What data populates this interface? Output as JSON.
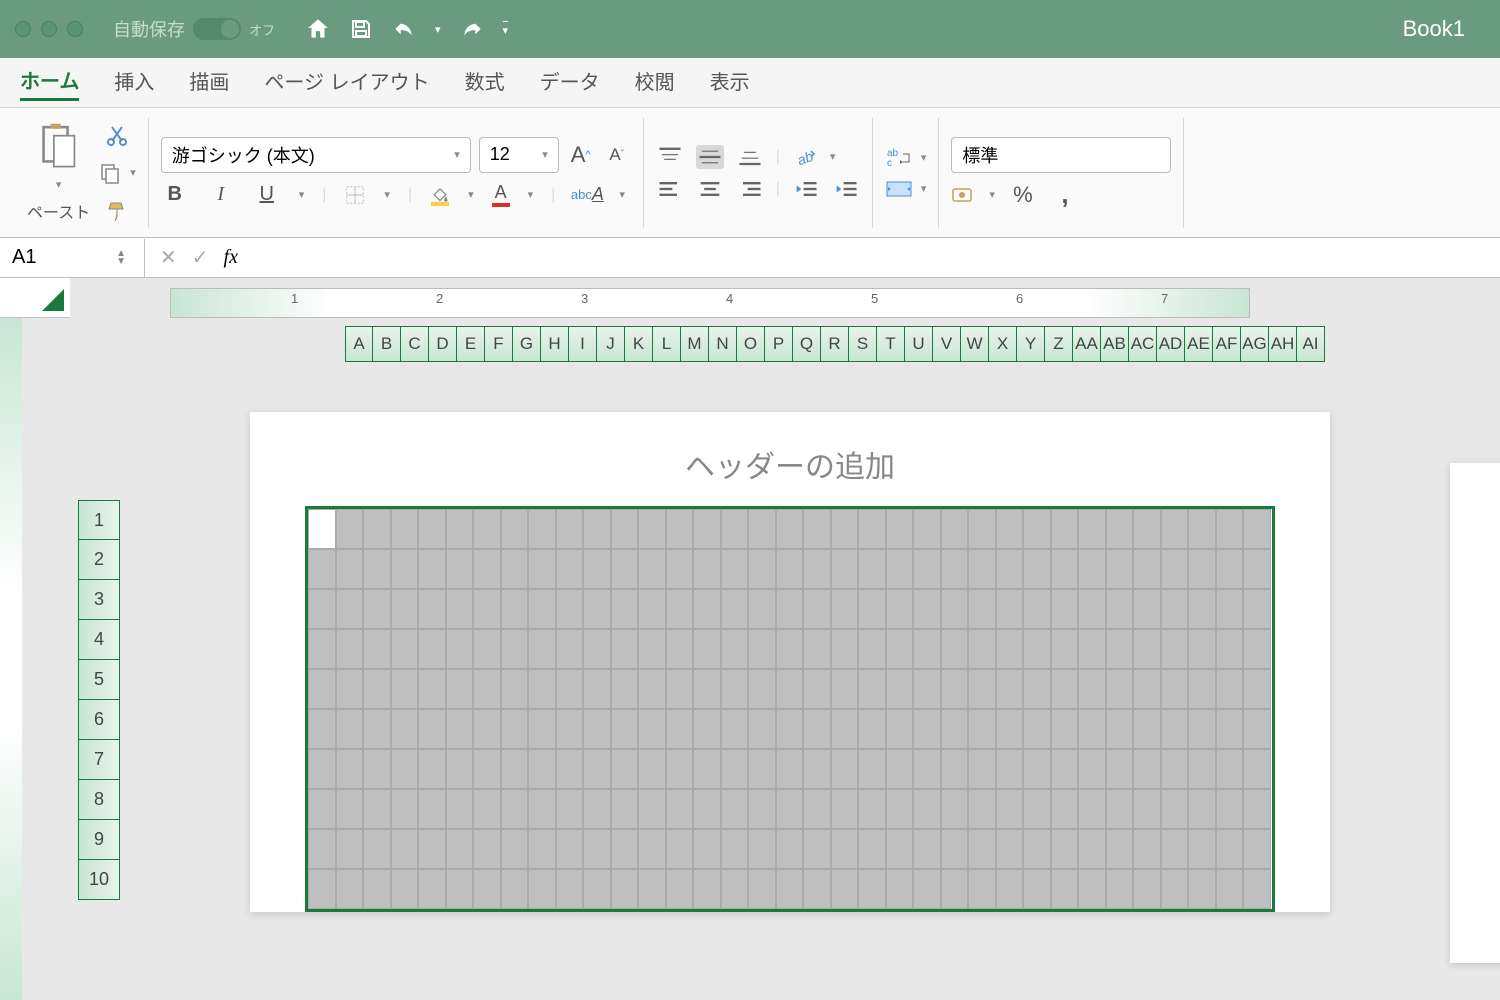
{
  "titlebar": {
    "autosave": "自動保存",
    "autosave_state": "オフ",
    "title": "Book1"
  },
  "tabs": [
    "ホーム",
    "挿入",
    "描画",
    "ページ レイアウト",
    "数式",
    "データ",
    "校閲",
    "表示"
  ],
  "active_tab": 0,
  "clipboard": {
    "paste": "ペースト"
  },
  "font": {
    "name": "游ゴシック (本文)",
    "size": "12"
  },
  "number_format": "標準",
  "namebox": "A1",
  "header_placeholder": "ヘッダーの追加",
  "columns": [
    "A",
    "B",
    "C",
    "D",
    "E",
    "F",
    "G",
    "H",
    "I",
    "J",
    "K",
    "L",
    "M",
    "N",
    "O",
    "P",
    "Q",
    "R",
    "S",
    "T",
    "U",
    "V",
    "W",
    "X",
    "Y",
    "Z",
    "AA",
    "AB",
    "AC",
    "AD",
    "AE",
    "AF",
    "AG",
    "AH",
    "AI"
  ],
  "columns2": [
    "A"
  ],
  "rows": [
    1,
    2,
    3,
    4,
    5,
    6,
    7,
    8,
    9,
    10
  ],
  "ruler_marks": [
    1,
    2,
    3,
    4,
    5,
    6,
    7
  ]
}
